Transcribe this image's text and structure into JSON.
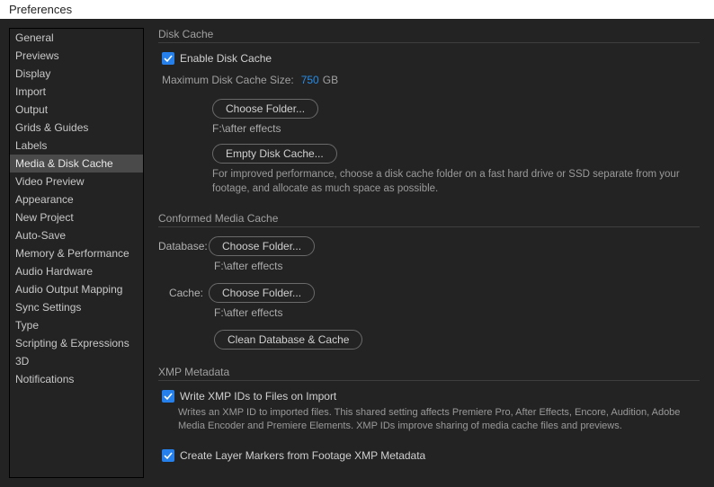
{
  "window": {
    "title": "Preferences"
  },
  "sidebar": {
    "items": [
      {
        "label": "General"
      },
      {
        "label": "Previews"
      },
      {
        "label": "Display"
      },
      {
        "label": "Import"
      },
      {
        "label": "Output"
      },
      {
        "label": "Grids & Guides"
      },
      {
        "label": "Labels"
      },
      {
        "label": "Media & Disk Cache"
      },
      {
        "label": "Video Preview"
      },
      {
        "label": "Appearance"
      },
      {
        "label": "New Project"
      },
      {
        "label": "Auto-Save"
      },
      {
        "label": "Memory & Performance"
      },
      {
        "label": "Audio Hardware"
      },
      {
        "label": "Audio Output Mapping"
      },
      {
        "label": "Sync Settings"
      },
      {
        "label": "Type"
      },
      {
        "label": "Scripting & Expressions"
      },
      {
        "label": "3D"
      },
      {
        "label": "Notifications"
      }
    ],
    "selected_index": 7
  },
  "disk_cache": {
    "section_title": "Disk Cache",
    "enable_label": "Enable Disk Cache",
    "enable_checked": true,
    "max_size_label": "Maximum Disk Cache Size:",
    "max_size_value": "750",
    "max_size_unit": "GB",
    "choose_folder_label": "Choose Folder...",
    "folder_path": "F:\\after effects",
    "empty_cache_label": "Empty Disk Cache...",
    "help_text": "For improved performance, choose a disk cache folder on a fast hard drive or SSD separate from your footage, and allocate as much space as possible."
  },
  "conformed_media": {
    "section_title": "Conformed Media Cache",
    "database_label": "Database:",
    "database_choose_label": "Choose Folder...",
    "database_path": "F:\\after effects",
    "cache_label": "Cache:",
    "cache_choose_label": "Choose Folder...",
    "cache_path": "F:\\after effects",
    "clean_label": "Clean Database & Cache"
  },
  "xmp": {
    "section_title": "XMP Metadata",
    "write_ids_label": "Write XMP IDs to Files on Import",
    "write_ids_checked": true,
    "write_ids_help": "Writes an XMP ID to imported files. This shared setting affects Premiere Pro, After Effects, Encore, Audition, Adobe Media Encoder and Premiere Elements. XMP IDs improve sharing of media cache files and previews.",
    "layer_markers_label": "Create Layer Markers from Footage XMP Metadata",
    "layer_markers_checked": true
  }
}
